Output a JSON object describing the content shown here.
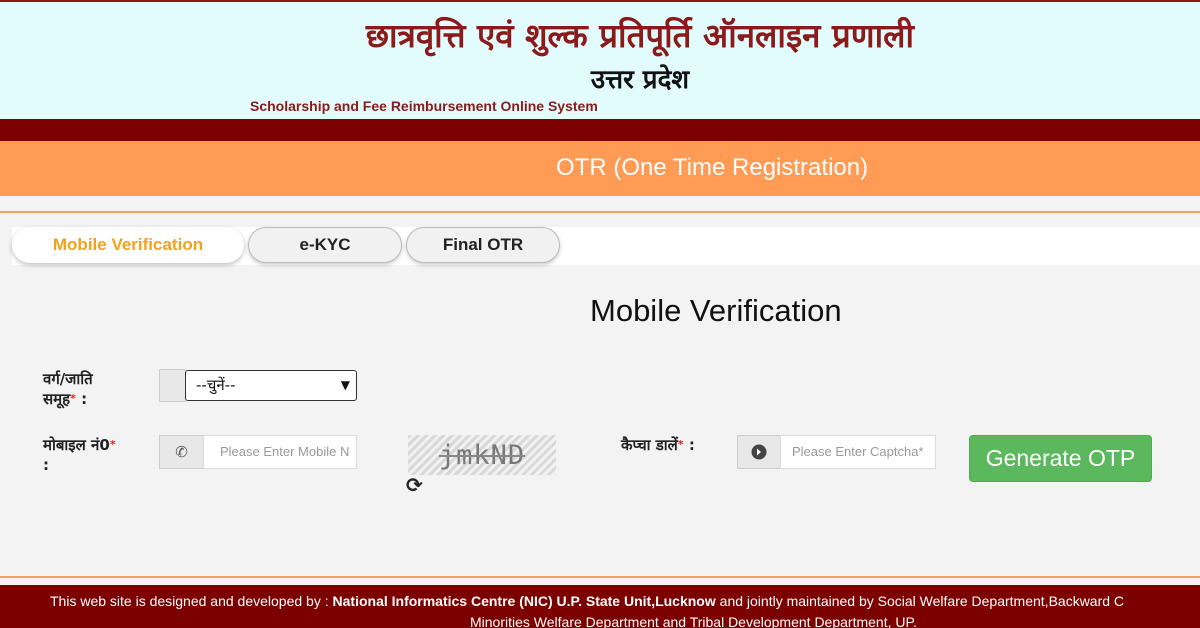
{
  "header": {
    "title_hindi": "छात्रवृत्ति एवं शुल्क प्रतिपूर्ति ऑनलाइन प्रणाली",
    "state": "उत्तर प्रदेश",
    "title_english": "Scholarship and Fee Reimbursement Online System"
  },
  "banner": {
    "title": "OTR (One Time Registration)"
  },
  "tabs": [
    {
      "label": "Mobile Verification",
      "active": true
    },
    {
      "label": "e-KYC",
      "active": false
    },
    {
      "label": "Final OTR",
      "active": false
    }
  ],
  "form": {
    "title": "Mobile Verification",
    "category_label_line1": "वर्ग/जाति",
    "category_label_line2": "समूह",
    "category_label_colon": " :",
    "category_select_value": "--चुनें--",
    "mobile_label": "मोबाइल नं0",
    "mobile_label_colon": ":",
    "mobile_placeholder": "Please Enter Mobile N",
    "captcha_text": "jmkND",
    "captcha_label": "कैप्चा डालें",
    "captcha_label_colon": " :",
    "captcha_placeholder": "Please Enter Captcha*",
    "generate_button": "Generate OTP",
    "required_mark": "*"
  },
  "footer": {
    "line1_prefix": "This web site is designed and developed by : ",
    "line1_bold": "National Informatics Centre (NIC) U.P. State Unit,Lucknow",
    "line1_suffix": " and jointly maintained by Social Welfare Department,Backward C",
    "line2": "Minorities Welfare Department and Tribal Development Department, UP."
  },
  "colors": {
    "maroon": "#7c0000",
    "orange_banner": "#ff9b55",
    "active_tab_text": "#f3a21c",
    "button_green": "#5cb85c",
    "header_bg": "#e2fbfd"
  },
  "icons": [
    "phone-icon",
    "arrow-circle-right-icon",
    "refresh-icon",
    "chevron-down-icon"
  ]
}
